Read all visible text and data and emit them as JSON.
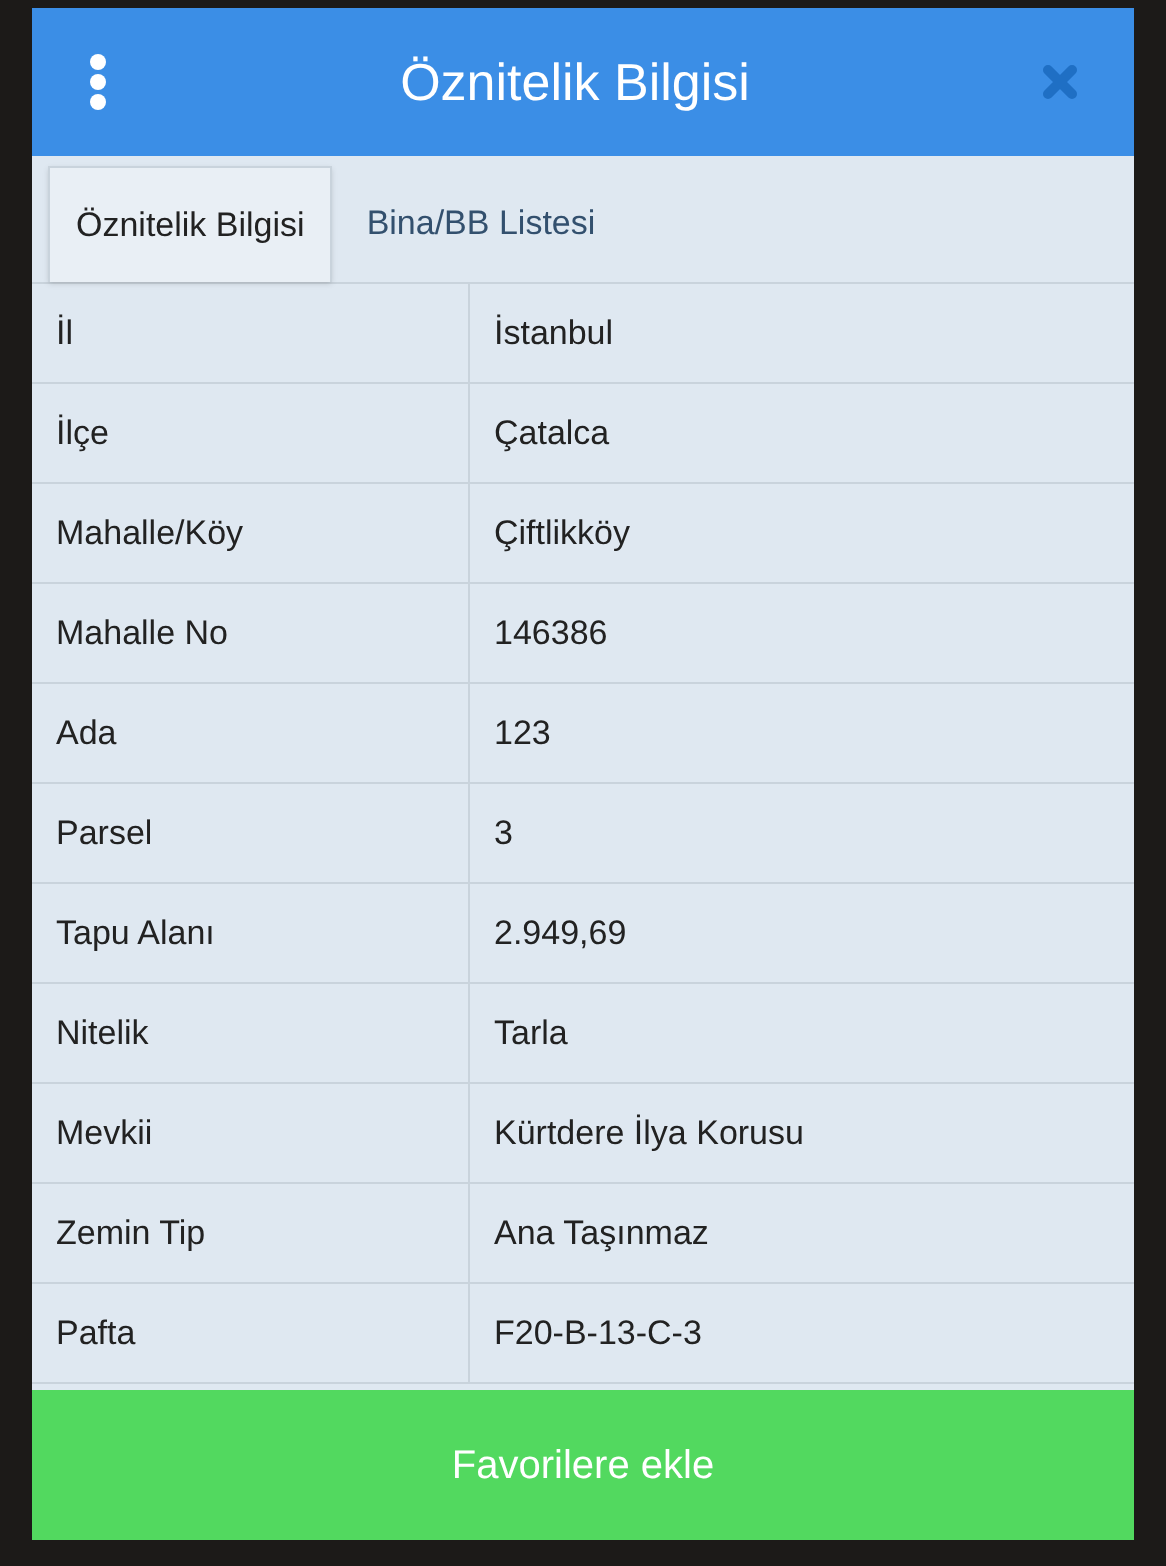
{
  "dialog": {
    "title": "Öznitelik Bilgisi"
  },
  "tabs": [
    {
      "label": "Öznitelik Bilgisi",
      "selected": true
    },
    {
      "label": "Bina/BB Listesi",
      "selected": false
    }
  ],
  "table": {
    "rows": [
      {
        "label": "İl",
        "value": "İstanbul"
      },
      {
        "label": "İlçe",
        "value": "Çatalca"
      },
      {
        "label": "Mahalle/Köy",
        "value": "Çiftlikköy"
      },
      {
        "label": "Mahalle No",
        "value": "146386"
      },
      {
        "label": "Ada",
        "value": "123"
      },
      {
        "label": "Parsel",
        "value": "3"
      },
      {
        "label": "Tapu Alanı",
        "value": "2.949,69"
      },
      {
        "label": "Nitelik",
        "value": "Tarla"
      },
      {
        "label": "Mevkii",
        "value": "Kürtdere İlya Korusu"
      },
      {
        "label": "Zemin Tip",
        "value": "Ana Taşınmaz"
      },
      {
        "label": "Pafta",
        "value": "F20-B-13-C-3"
      }
    ]
  },
  "button": {
    "label": "Favorilere ekle"
  }
}
